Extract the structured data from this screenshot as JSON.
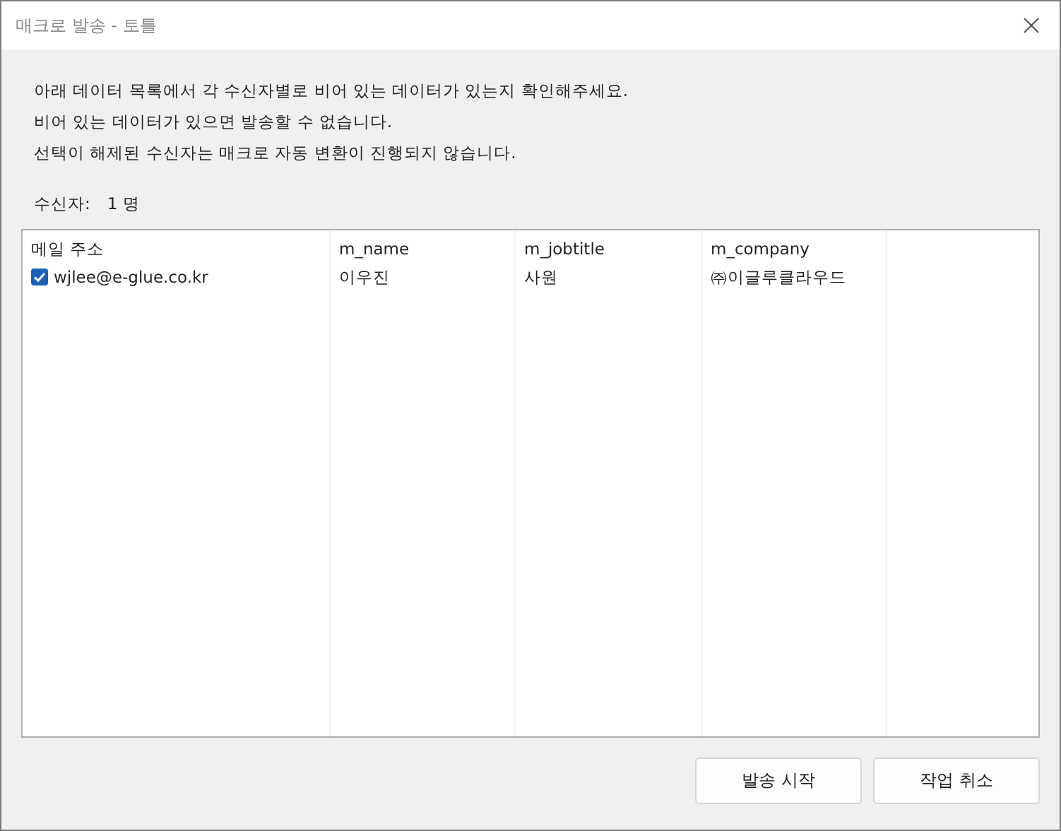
{
  "window": {
    "title": "매크로 발송 - 토틀"
  },
  "messages": [
    "아래 데이터 목록에서 각 수신자별로 비어 있는 데이터가 있는지 확인해주세요.",
    "비어 있는 데이터가 있으면 발송할 수 없습니다.",
    "선택이 해제된 수신자는 매크로 자동 변환이 진행되지 않습니다."
  ],
  "recipients": {
    "label": "수신자:",
    "count": "1 명"
  },
  "table": {
    "columns": [
      "메일 주소",
      "m_name",
      "m_jobtitle",
      "m_company"
    ],
    "rows": [
      {
        "checked": true,
        "cells": [
          "wjlee@e-glue.co.kr",
          "이우진",
          "사원",
          "㈜이글루클라우드"
        ]
      }
    ]
  },
  "buttons": [
    "발송 시작",
    "작업 취소"
  ]
}
